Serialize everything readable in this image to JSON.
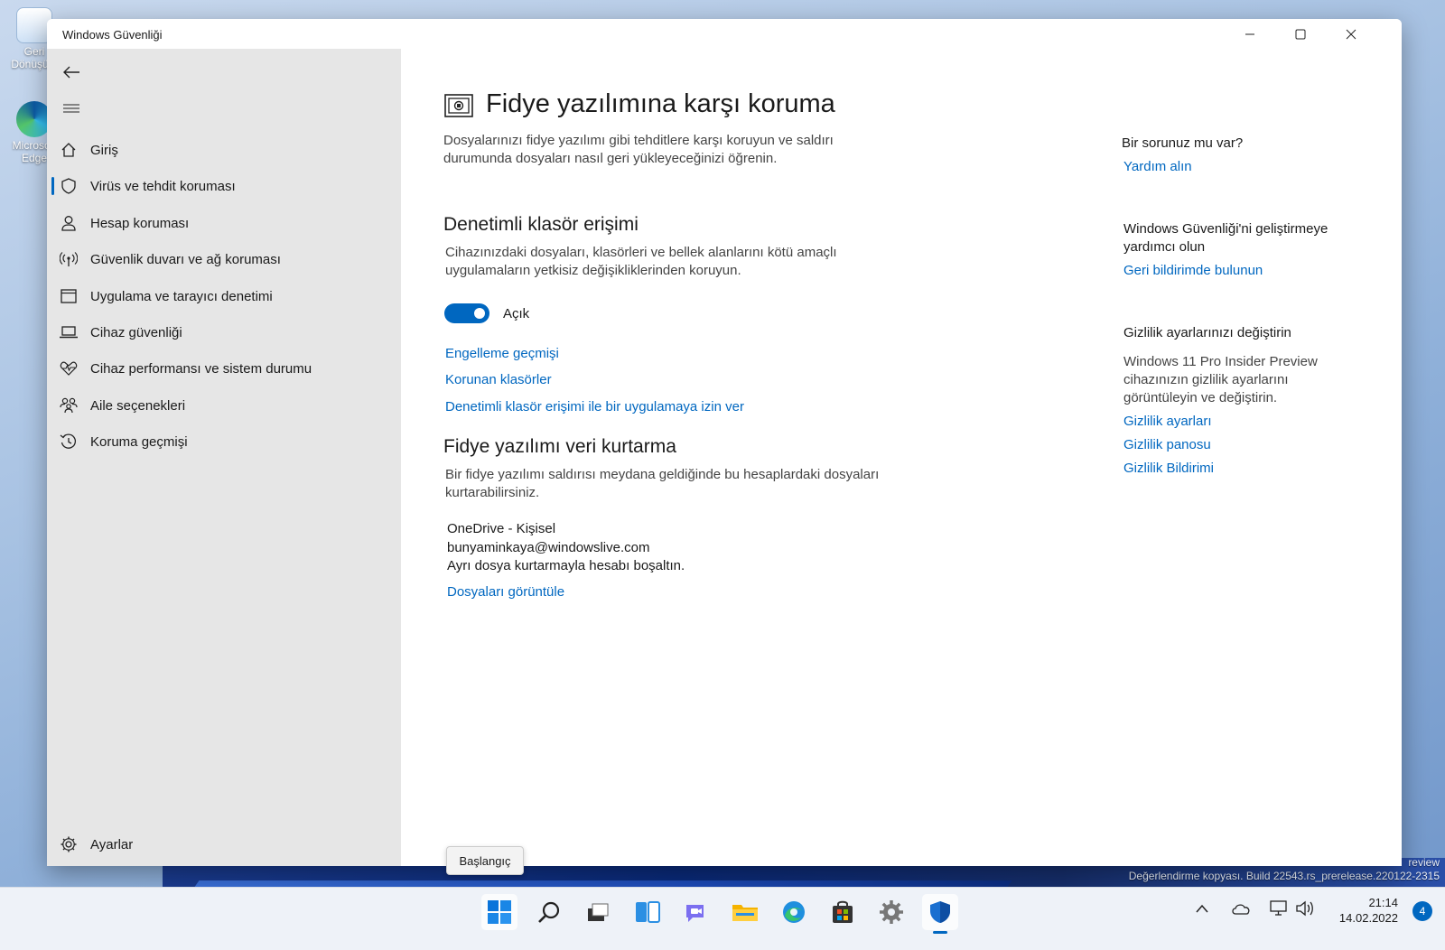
{
  "desktop": {
    "icons": [
      {
        "label": "Geri Dönüşüm"
      },
      {
        "label": "Microsoft Edge"
      }
    ],
    "watermark_line1": "review",
    "watermark_line2": "Değerlendirme kopyası. Build 22543.rs_prerelease.220122-2315"
  },
  "window": {
    "title": "Windows Güvenliği",
    "controls": {
      "minimize": "—",
      "maximize": "☐",
      "close": "✕"
    }
  },
  "sidebar": {
    "back_icon": "back-arrow-icon",
    "menu_icon": "hamburger-icon",
    "items": [
      {
        "label": "Giriş",
        "icon": "home-icon"
      },
      {
        "label": "Virüs ve tehdit koruması",
        "icon": "shield-icon",
        "active": true
      },
      {
        "label": "Hesap koruması",
        "icon": "person-icon"
      },
      {
        "label": "Güvenlik duvarı ve ağ koruması",
        "icon": "antenna-icon"
      },
      {
        "label": "Uygulama ve tarayıcı denetimi",
        "icon": "app-window-icon"
      },
      {
        "label": "Cihaz güvenliği",
        "icon": "laptop-icon"
      },
      {
        "label": "Cihaz performansı ve sistem durumu",
        "icon": "heartbeat-icon"
      },
      {
        "label": "Aile seçenekleri",
        "icon": "family-icon"
      },
      {
        "label": "Koruma geçmişi",
        "icon": "history-icon"
      }
    ],
    "settings_label": "Ayarlar"
  },
  "main": {
    "title": "Fidye yazılımına karşı koruma",
    "intro_line1": "Dosyalarınızı fidye yazılımı gibi tehditlere karşı koruyun ve saldırı",
    "intro_line2": "durumunda dosyaları nasıl geri yükleyeceğinizi öğrenin.",
    "cfa": {
      "heading": "Denetimli klasör erişimi",
      "desc_line1": "Cihazınızdaki dosyaları, klasörleri ve bellek alanlarını kötü amaçlı",
      "desc_line2": "uygulamaların yetkisiz değişikliklerinden koruyun.",
      "toggle_on": true,
      "toggle_label": "Açık",
      "links": [
        "Engelleme geçmişi",
        "Korunan klasörler",
        "Denetimli klasör erişimi ile bir uygulamaya izin ver"
      ]
    },
    "recovery": {
      "heading": "Fidye yazılımı veri kurtarma",
      "desc_line1": "Bir fidye yazılımı saldırısı meydana geldiğinde bu hesaplardaki dosyaları",
      "desc_line2": "kurtarabilirsiniz.",
      "account_name": "OneDrive - Kişisel",
      "account_email": "bunyaminkaya@windowslive.com",
      "account_note": "Ayrı dosya kurtarmayla hesabı boşaltın.",
      "view_files_link": "Dosyaları görüntüle"
    }
  },
  "right_panel": {
    "q_heading": "Bir sorunuz mu var?",
    "help_link": "Yardım alın",
    "improve_line1": "Windows Güvenliği'ni geliştirmeye",
    "improve_line2": "yardımcı olun",
    "feedback_link": "Geri bildirimde bulunun",
    "privacy_heading": "Gizlilik ayarlarınızı değiştirin",
    "privacy_line1": "Windows 11 Pro Insider Preview",
    "privacy_line2": "cihazınızın gizlilik ayarlarını",
    "privacy_line3": "görüntüleyin ve değiştirin.",
    "privacy_links": [
      "Gizlilik ayarları",
      "Gizlilik panosu",
      "Gizlilik Bildirimi"
    ]
  },
  "tooltip": "Başlangıç",
  "taskbar": {
    "apps": [
      "start-icon",
      "search-icon",
      "task-view-icon",
      "widgets-icon",
      "chat-icon",
      "file-explorer-icon",
      "edge-icon",
      "store-icon",
      "settings-icon",
      "windows-security-icon"
    ],
    "time": "21:14",
    "date": "14.02.2022",
    "notification_count": "4"
  },
  "colors": {
    "accent": "#0067c0",
    "sidebar_bg": "#e6e6e6",
    "window_bg": "#ffffff"
  }
}
